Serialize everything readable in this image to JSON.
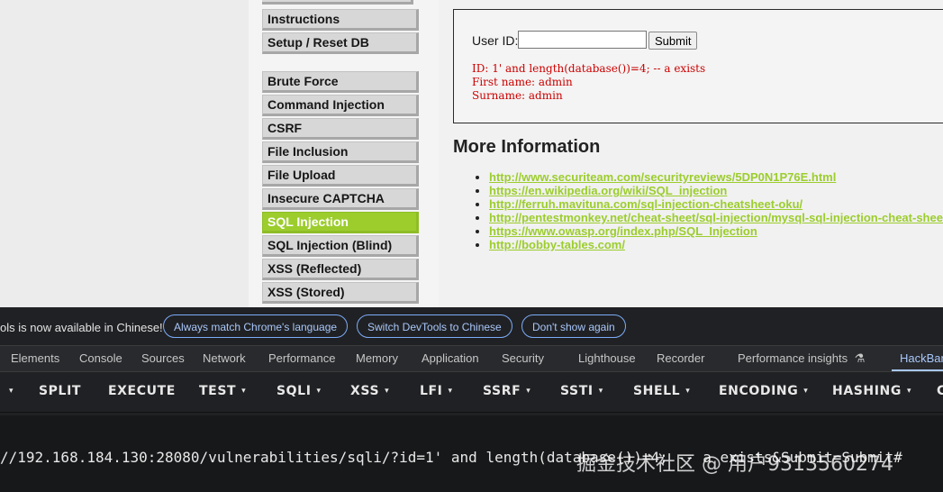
{
  "menu": {
    "items": [
      {
        "label": "Instructions"
      },
      {
        "label": "Setup / Reset DB"
      },
      {
        "label": "Brute Force"
      },
      {
        "label": "Command Injection"
      },
      {
        "label": "CSRF"
      },
      {
        "label": "File Inclusion"
      },
      {
        "label": "File Upload"
      },
      {
        "label": "Insecure CAPTCHA"
      },
      {
        "label": "SQL Injection",
        "active": true
      },
      {
        "label": "SQL Injection (Blind)"
      },
      {
        "label": "XSS (Reflected)"
      },
      {
        "label": "XSS (Stored)"
      }
    ]
  },
  "form": {
    "user_id_label": "User ID:",
    "user_id_value": "",
    "submit_label": "Submit"
  },
  "output": {
    "line1": "ID: 1' and length(database())=4; -- a exists",
    "line2": "First name: admin",
    "line3": "Surname: admin"
  },
  "more_info": {
    "heading": "More Information",
    "links": [
      "http://www.securiteam.com/securityreviews/5DP0N1P76E.html",
      "https://en.wikipedia.org/wiki/SQL_injection",
      "http://ferruh.mavituna.com/sql-injection-cheatsheet-oku/",
      "http://pentestmonkey.net/cheat-sheet/sql-injection/mysql-sql-injection-cheat-sheet",
      "https://www.owasp.org/index.php/SQL_Injection",
      "http://bobby-tables.com/"
    ]
  },
  "devtools": {
    "infobar": {
      "text": "ols is now available in Chinese!",
      "btn_match": "Always match Chrome's language",
      "btn_switch": "Switch DevTools to Chinese",
      "btn_dont_show": "Don't show again"
    },
    "tabs": [
      "Elements",
      "Console",
      "Sources",
      "Network",
      "Performance",
      "Memory",
      "Application",
      "Security",
      "Lighthouse",
      "Recorder",
      "Performance insights",
      "HackBar"
    ],
    "active_tab": "HackBar",
    "flask_icon_glyph": "⚗",
    "hackbar": {
      "buttons": [
        "SPLIT",
        "EXECUTE",
        "TEST",
        "SQLI",
        "XSS",
        "LFI",
        "SSRF",
        "SSTI",
        "SHELL",
        "ENCODING",
        "HASHING",
        "C"
      ],
      "caret": "▾",
      "url": "//192.168.184.130:28080/vulnerabilities/sqli/?id=1' and length(database())=4; -- a exists&Submit=Submit#",
      "watermark": "掘金技术社区 @ 用户9313560274"
    }
  }
}
